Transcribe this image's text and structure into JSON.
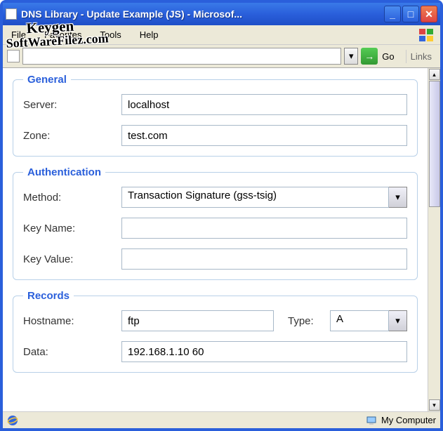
{
  "window": {
    "title": "DNS Library - Update Example (JS) - Microsof..."
  },
  "menu": {
    "file": "File",
    "favorites": "Favorites",
    "tools": "Tools",
    "help": "Help"
  },
  "addr": {
    "go": "Go",
    "links": "Links"
  },
  "general": {
    "legend": "General",
    "server_label": "Server:",
    "server_value": "localhost",
    "zone_label": "Zone:",
    "zone_value": "test.com"
  },
  "auth": {
    "legend": "Authentication",
    "method_label": "Method:",
    "method_value": "Transaction Signature (gss-tsig)",
    "keyname_label": "Key Name:",
    "keyname_value": "",
    "keyvalue_label": "Key Value:",
    "keyvalue_value": ""
  },
  "records": {
    "legend": "Records",
    "hostname_label": "Hostname:",
    "hostname_value": "ftp",
    "type_label": "Type:",
    "type_value": "A",
    "data_label": "Data:",
    "data_value": "192.168.1.10 60"
  },
  "status": {
    "zone": "My Computer"
  },
  "watermark": {
    "l1": "Keygen",
    "l2": "SoftWareFilez.com"
  }
}
